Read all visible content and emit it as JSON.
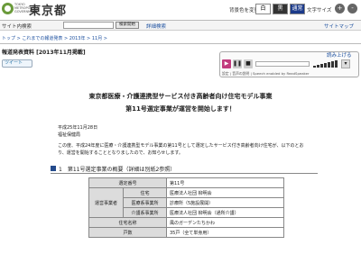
{
  "header": {
    "logo_sub": "TOKYO METROPOLITAN GOVERNMENT",
    "logo_text": "東京都",
    "font_color_label": "背景色を変更",
    "color_buttons": [
      "白",
      "黒",
      "通常"
    ],
    "font_size_label": "文字サイズ",
    "size_plus": "+",
    "size_minus": "-"
  },
  "search": {
    "label": "サイト内検索",
    "placeholder": "",
    "button": "検索開始",
    "advanced": "詳細検索",
    "sitemap": "サイトマップ"
  },
  "breadcrumb": "トップ > これまでの報道発表 > 2013年 > 11月 >",
  "press": {
    "title": "報道発表資料 [2013年11月掲載]",
    "tweet": "ツイート"
  },
  "readspeaker": {
    "listen": "読み上げる",
    "credit": "設定 | 音声の説明 | Speech enabled by ReadSpeaker"
  },
  "article": {
    "title1": "東京都医療・介護連携型サービス付き高齢者向け住宅モデル事業",
    "title2": "第11号選定事業が運営を開始します！",
    "date": "平成25年11月28日",
    "bureau": "福祉保健局",
    "body": "この度、平成24年度に医療・介護連携型モデル事業の第11号として選定したサービス付き高齢者向け住宅が、以下のとおり、運営を開始することとなりましたので、お知らせします。",
    "section_title": "1　第11号選定事業の概要（詳細は別紙2参照）"
  },
  "table": {
    "rows": [
      {
        "label": "選定番号",
        "value": "第11号"
      },
      {
        "group": "運営事業者",
        "label": "住宅",
        "value": "医療法人社団 柳明会"
      },
      {
        "label": "医療系事業所",
        "value": "診療所（5施設展開）"
      },
      {
        "label": "介護系事業所",
        "value": "医療法人社団 柳明会（通所介護）"
      },
      {
        "label": "住宅名称",
        "value": "風のガーデンたちかわ"
      },
      {
        "label": "戸数",
        "value": "35戸（全て単身用）"
      }
    ]
  }
}
